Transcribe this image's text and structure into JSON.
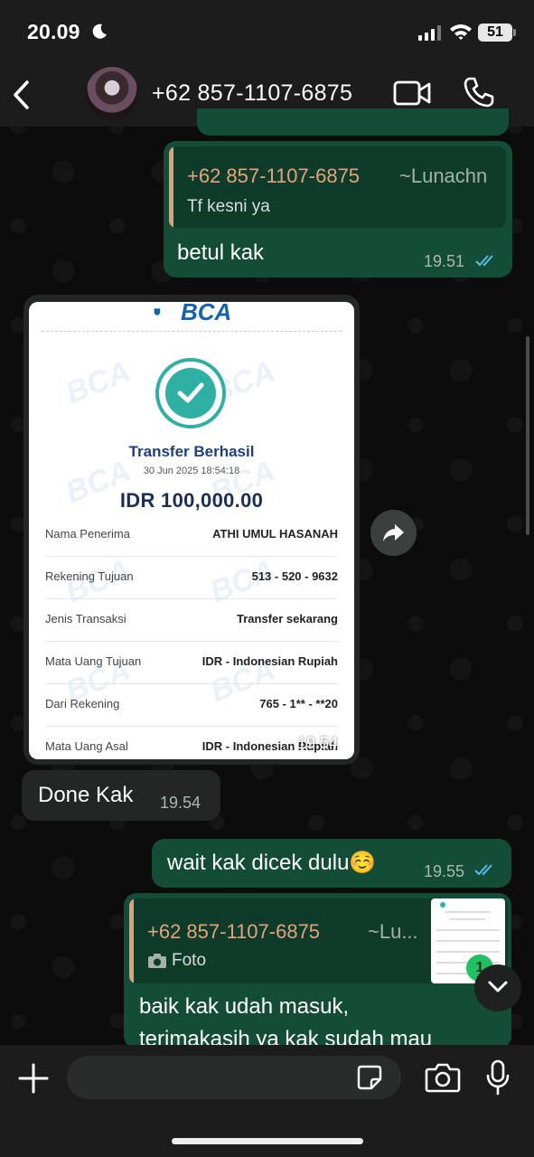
{
  "status_bar": {
    "time": "20.09",
    "battery": "51"
  },
  "header": {
    "contact": "+62 857-1107-6875"
  },
  "messages": {
    "m1": {
      "quote_sender": "+62 857-1107-6875",
      "quote_author": "~Lunachn",
      "quote_text": "Tf kesni ya",
      "text": "betul kak",
      "time": "19.51"
    },
    "receipt": {
      "bank": "BCA",
      "title": "Transfer Berhasil",
      "datetime": "30 Jun 2025 18:54:18",
      "amount": "IDR 100,000.00",
      "rows": [
        {
          "label": "Nama Penerima",
          "value": "ATHI UMUL HASANAH"
        },
        {
          "label": "Rekening Tujuan",
          "value": "513 - 520 - 9632"
        },
        {
          "label": "Jenis Transaksi",
          "value": "Transfer sekarang"
        },
        {
          "label": "Mata Uang Tujuan",
          "value": "IDR - Indonesian Rupiah"
        },
        {
          "label": "Dari Rekening",
          "value": "765 - 1** - **20"
        },
        {
          "label": "Mata Uang Asal",
          "value": "IDR - Indonesian Rupiah"
        }
      ],
      "time": "19.54"
    },
    "m2": {
      "text": "Done Kak",
      "time": "19.54"
    },
    "m3": {
      "text": "wait kak dicek dulu☺️",
      "time": "19.55"
    },
    "m4": {
      "quote_sender": "+62 857-1107-6875",
      "quote_author": "~Lu...",
      "quote_type": "Foto",
      "text_line1": "baik kak udah masuk,",
      "text_line2": "terimakasih ya kak sudah mau"
    }
  },
  "unread_badge": "1",
  "input": {
    "placeholder": ""
  },
  "colors": {
    "outgoing": "#144d37",
    "incoming": "#242626",
    "quote_accent": "#d9a27a",
    "ticks": "#53bdeb",
    "badge": "#21c063"
  }
}
